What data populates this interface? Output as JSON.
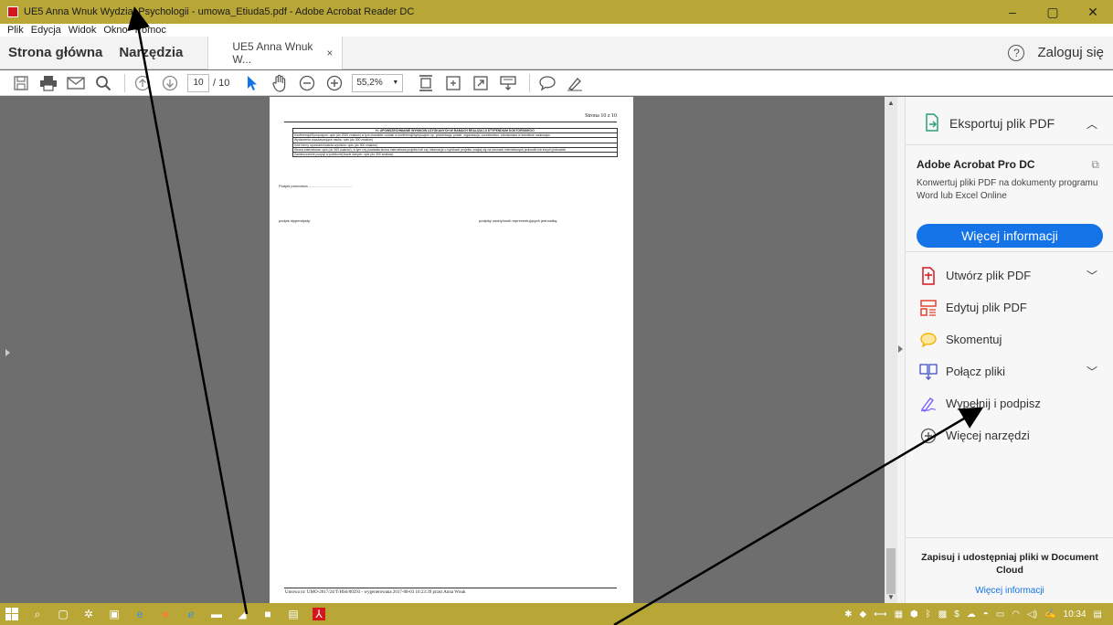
{
  "window": {
    "title": "UE5 Anna Wnuk Wydział Psychologii - umowa_Etiuda5.pdf - Adobe Acrobat Reader DC",
    "minimize": "–",
    "maximize": "▢",
    "close": "✕"
  },
  "menu": [
    "Plik",
    "Edycja",
    "Widok",
    "Okno",
    "Pomoc"
  ],
  "tabs": {
    "home": "Strona główna",
    "tools": "Narzędzia",
    "document": "UE5 Anna Wnuk W...",
    "close": "×",
    "login": "Zaloguj się",
    "help": "?"
  },
  "toolbar": {
    "page_current": "10",
    "page_total": "/ 10",
    "zoom": "55,2%"
  },
  "document": {
    "header": "Strona 10 z 10",
    "table_rows": [
      "H.   UPOWSZECHNIANIE WYNIKÓW UZYSKANYCH W RAMACH REALIZACJI STYPENDIUM DOKTORSKIEGO",
      "Konferencja/Sympozjum: opis (do 2000 znaków) w tym charakter udziału w konferencji/sympozjum np. prezentacja, poster, organizacja, uczestnictwo, członkostwo w komitecie naukowym",
      "Wydarzenia popularyzujące naukę: opis (do 300 znaków)",
      "Inne formy upowszechniania wyników: opis (do 300 znaków)",
      "Strona internetowa: opis (do 300 znaków), w tym czy powstała strona internetowa projektu lub czy informacje o wynikach projektu znajdą się na stronach internetowych jednostki lub innych jednostek",
      "Zamieszczenie pozycji w publicznej bazie danych: opis (do 300 znaków)"
    ],
    "signature_promotor": "Podpis promotora ………………………………",
    "signature_student": "podpis stypendysty:",
    "signature_reps": "podpisy osoby/osób reprezentujących jednostkę:",
    "footer": "Umowa nr: UMO-2017/24/T/HS6/00293 - wygenerowana 2017-08-03 10:23:39 przez Anna Wnuk"
  },
  "panel": {
    "export": "Eksportuj plik PDF",
    "promo_title": "Adobe Acrobat Pro DC",
    "promo_desc": "Konwertuj pliki PDF na dokumenty programu Word lub Excel Online",
    "promo_button": "Więcej informacji",
    "tools": [
      {
        "label": "Utwórz plik PDF",
        "icon": "create-pdf-icon",
        "color": "#d4161d"
      },
      {
        "label": "Edytuj plik PDF",
        "icon": "edit-pdf-icon",
        "color": "#e8412f"
      },
      {
        "label": "Skomentuj",
        "icon": "comment-icon",
        "color": "#f2b200"
      },
      {
        "label": "Połącz pliki",
        "icon": "combine-files-icon",
        "color": "#4f5cc7"
      },
      {
        "label": "Wypełnij i podpisz",
        "icon": "fill-sign-icon",
        "color": "#7b61ff"
      },
      {
        "label": "Więcej narzędzi",
        "icon": "more-tools-icon",
        "color": "#555555"
      }
    ],
    "bottom_title": "Zapisuj i udostępniaj pliki w Document Cloud",
    "bottom_link": "Więcej informacji"
  },
  "taskbar": {
    "time": "10:34"
  },
  "colors": {
    "accent": "#1473e6",
    "titlebar": "#b8a637",
    "viewer_bg": "#6e6e6e"
  }
}
